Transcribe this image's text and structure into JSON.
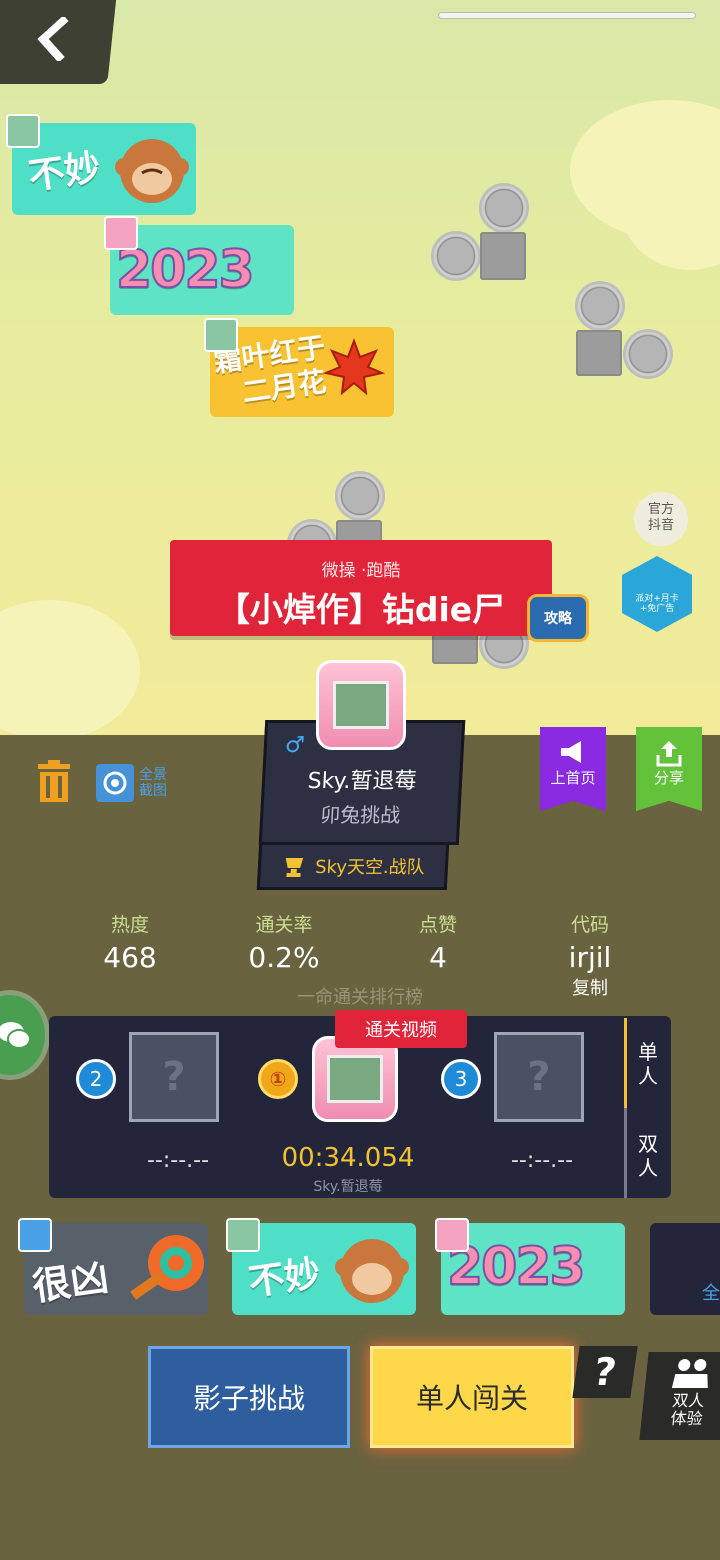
{
  "tags_top": [
    {
      "text": "不妙",
      "bg": "#4fdfc7"
    },
    {
      "text": "2023",
      "bg": "#5ee4c4"
    },
    {
      "text": "霜叶红于二月花",
      "line1": "霜叶红于",
      "line2": "二月花",
      "bg": "#f9c232"
    }
  ],
  "banner": {
    "subtitle": "微操 ·跑酷",
    "title": "【小焯作】钻die尸"
  },
  "tv_label": "攻略",
  "official_label": {
    "line1": "官方",
    "line2": "抖音"
  },
  "promo_label": {
    "line1": "派对+月卡",
    "line2": "+免广告"
  },
  "camera_label": {
    "line1": "全景",
    "line2": "截图"
  },
  "author": {
    "gender_icon": "♂",
    "name": "Sky.暂退莓",
    "challenge": "卯兔挑战",
    "team": "Sky天空.战队"
  },
  "ribbons": {
    "home": "上首页",
    "share": "分享",
    "home_color": "#8a2be2",
    "share_color": "#64c23a"
  },
  "stats": [
    {
      "label": "热度",
      "value": "468"
    },
    {
      "label": "通关率",
      "value": "0.2%"
    },
    {
      "label": "点赞",
      "value": "4"
    },
    {
      "label": "代码",
      "value": "irjil",
      "copy": "复制"
    }
  ],
  "leaderboard": {
    "title": "一命通关排行榜",
    "video_tag": "通关视频",
    "rank2": "2",
    "rank1": "①",
    "rank3": "3",
    "time2": "--:--.--",
    "time1": "00:34.054",
    "time3": "--:--.--",
    "player1": "Sky.暂退莓",
    "mode_single": {
      "line1": "单",
      "line2": "人"
    },
    "mode_duo": {
      "line1": "双",
      "line2": "人"
    }
  },
  "tags_bottom": [
    {
      "text": "很凶"
    },
    {
      "text": "不妙"
    },
    {
      "text": "2023"
    },
    {
      "text": "全"
    }
  ],
  "buttons": {
    "shadow": "影子挑战",
    "solo": "单人闯关",
    "help": "?",
    "duo": {
      "line1": "双人",
      "line2": "体验"
    }
  }
}
